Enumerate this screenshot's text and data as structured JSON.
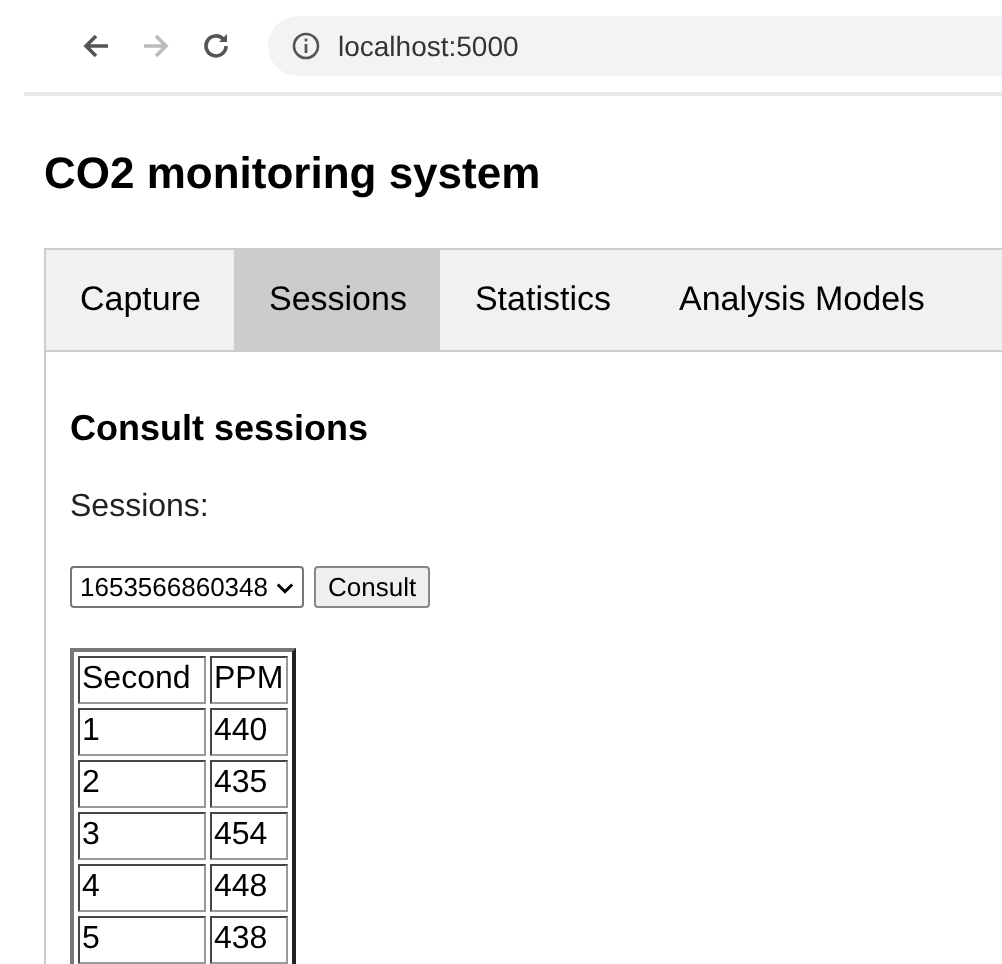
{
  "browser": {
    "url": "localhost:5000"
  },
  "page_title": "CO2 monitoring system",
  "tabs": [
    {
      "label": "Capture",
      "selected": false
    },
    {
      "label": "Sessions",
      "selected": true
    },
    {
      "label": "Statistics",
      "selected": false
    },
    {
      "label": "Analysis Models",
      "selected": false
    }
  ],
  "section_heading": "Consult sessions",
  "sessions_label": "Sessions:",
  "session_select": {
    "value": "1653566860348"
  },
  "consult_button": "Consult",
  "table": {
    "columns": [
      "Second",
      "PPM"
    ],
    "rows": [
      [
        "1",
        "440"
      ],
      [
        "2",
        "435"
      ],
      [
        "3",
        "454"
      ],
      [
        "4",
        "448"
      ],
      [
        "5",
        "438"
      ]
    ]
  }
}
